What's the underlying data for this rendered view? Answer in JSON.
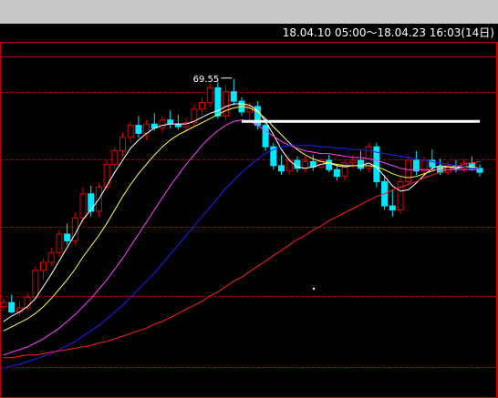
{
  "window": {
    "titlebar_color": "#c8c8c8"
  },
  "header": {
    "range_text": "18.04.10 05:00～18.04.23 16:03(14日)"
  },
  "colors": {
    "background": "#000000",
    "frame": "#c00000",
    "grid": "#a00000",
    "up_candle": "#e00000",
    "down_candle": "#00e8ff",
    "ma_white": "#ffffff",
    "ma_yellow": "#ffff40",
    "ma_magenta": "#ff40ff",
    "ma_blue": "#2020ff",
    "ma_red": "#ff2020",
    "trendline": "#ffffff"
  },
  "chart_data": {
    "type": "candlestick",
    "title": "",
    "high_label": "69.55",
    "ylim": [
      46.0,
      71.5
    ],
    "grid": true,
    "candles": [
      [
        52.6,
        53.2,
        52.3,
        52.9
      ],
      [
        52.9,
        53.5,
        52.1,
        52.2
      ],
      [
        52.2,
        53.0,
        51.9,
        52.5
      ],
      [
        52.5,
        53.6,
        52.3,
        53.3
      ],
      [
        53.3,
        55.6,
        53.1,
        55.3
      ],
      [
        55.3,
        56.2,
        54.6,
        55.9
      ],
      [
        55.9,
        57.0,
        55.6,
        56.6
      ],
      [
        56.6,
        58.3,
        56.3,
        58.0
      ],
      [
        58.0,
        58.8,
        57.2,
        57.5
      ],
      [
        57.5,
        59.6,
        57.2,
        59.2
      ],
      [
        59.2,
        61.5,
        58.8,
        61.0
      ],
      [
        61.0,
        61.6,
        59.3,
        59.7
      ],
      [
        59.7,
        61.8,
        59.3,
        61.5
      ],
      [
        61.5,
        63.5,
        61.2,
        63.2
      ],
      [
        63.2,
        64.5,
        62.9,
        64.2
      ],
      [
        64.2,
        65.6,
        63.8,
        65.2
      ],
      [
        65.2,
        66.4,
        64.8,
        66.1
      ],
      [
        66.1,
        66.8,
        65.2,
        65.5
      ],
      [
        65.5,
        66.5,
        65.0,
        66.2
      ],
      [
        66.2,
        67.0,
        65.7,
        65.9
      ],
      [
        65.9,
        66.8,
        65.5,
        66.5
      ],
      [
        66.5,
        67.2,
        65.9,
        66.2
      ],
      [
        66.2,
        66.9,
        65.8,
        66.0
      ],
      [
        66.0,
        66.6,
        65.6,
        66.3
      ],
      [
        66.3,
        67.6,
        66.0,
        67.3
      ],
      [
        67.3,
        68.2,
        66.9,
        67.8
      ],
      [
        67.8,
        69.2,
        67.5,
        68.9
      ],
      [
        68.9,
        69.3,
        66.6,
        66.8
      ],
      [
        66.8,
        69.1,
        66.5,
        68.6
      ],
      [
        68.6,
        69.55,
        67.6,
        67.9
      ],
      [
        67.9,
        68.2,
        66.8,
        67.1
      ],
      [
        67.1,
        67.8,
        66.5,
        67.5
      ],
      [
        67.5,
        67.9,
        65.8,
        66.1
      ],
      [
        66.1,
        66.6,
        64.2,
        64.5
      ],
      [
        64.5,
        64.8,
        62.8,
        63.1
      ],
      [
        63.1,
        63.9,
        62.4,
        62.7
      ],
      [
        62.7,
        63.7,
        62.4,
        63.5
      ],
      [
        63.5,
        63.8,
        62.6,
        62.9
      ],
      [
        62.9,
        63.8,
        62.6,
        63.4
      ],
      [
        63.4,
        63.9,
        62.7,
        63.0
      ],
      [
        63.0,
        63.7,
        62.8,
        63.5
      ],
      [
        63.5,
        63.9,
        62.6,
        62.8
      ],
      [
        62.8,
        63.2,
        62.0,
        62.3
      ],
      [
        62.3,
        63.6,
        62.0,
        63.3
      ],
      [
        63.3,
        63.9,
        62.9,
        63.5
      ],
      [
        63.5,
        64.2,
        62.7,
        62.9
      ],
      [
        62.9,
        64.8,
        62.6,
        64.5
      ],
      [
        64.5,
        64.8,
        61.5,
        61.9
      ],
      [
        61.9,
        62.4,
        59.8,
        60.1
      ],
      [
        60.1,
        61.3,
        59.3,
        59.8
      ],
      [
        59.8,
        62.2,
        59.5,
        61.9
      ],
      [
        61.9,
        63.8,
        61.6,
        63.5
      ],
      [
        63.5,
        64.2,
        62.4,
        62.7
      ],
      [
        62.7,
        63.8,
        62.3,
        63.5
      ],
      [
        63.5,
        64.3,
        62.8,
        63.0
      ],
      [
        63.0,
        63.6,
        62.4,
        62.6
      ],
      [
        62.6,
        63.4,
        62.4,
        63.1
      ],
      [
        63.1,
        63.5,
        62.6,
        62.9
      ],
      [
        62.9,
        63.6,
        62.6,
        63.3
      ],
      [
        63.3,
        63.8,
        62.7,
        62.9
      ],
      [
        62.9,
        63.2,
        62.3,
        62.6
      ]
    ],
    "moving_averages": [
      {
        "color": "#ffffff",
        "values": [
          51.5,
          51.9,
          52.2,
          52.6,
          53.2,
          54.1,
          55.0,
          56.0,
          57.0,
          58.0,
          59.1,
          59.8,
          60.6,
          61.6,
          62.6,
          63.5,
          64.4,
          65.0,
          65.5,
          65.9,
          66.1,
          66.2,
          66.2,
          66.2,
          66.4,
          66.7,
          67.0,
          67.2,
          67.5,
          67.7,
          67.7,
          67.6,
          67.2,
          66.4,
          65.4,
          64.3,
          63.5,
          63.0,
          62.9,
          63.0,
          63.2,
          63.3,
          63.1,
          63.0,
          63.1,
          63.1,
          63.3,
          63.0,
          62.3,
          61.6,
          61.2,
          61.3,
          61.8,
          62.4,
          62.9,
          63.1,
          63.0,
          62.9,
          63.0,
          63.0,
          62.9
        ]
      },
      {
        "color": "#ffff40",
        "values": [
          50.8,
          51.1,
          51.4,
          51.7,
          52.1,
          52.6,
          53.2,
          53.9,
          54.6,
          55.4,
          56.3,
          57.1,
          57.9,
          58.8,
          59.8,
          60.8,
          61.7,
          62.5,
          63.2,
          63.9,
          64.5,
          65.0,
          65.4,
          65.7,
          66.0,
          66.3,
          66.6,
          66.9,
          67.2,
          67.4,
          67.5,
          67.4,
          67.1,
          66.6,
          66.0,
          65.4,
          64.8,
          64.3,
          63.9,
          63.6,
          63.4,
          63.3,
          63.2,
          63.1,
          63.1,
          63.1,
          63.1,
          63.0,
          62.8,
          62.5,
          62.3,
          62.2,
          62.3,
          62.5,
          62.7,
          62.9,
          63.0,
          63.0,
          63.0,
          63.0,
          62.9
        ]
      },
      {
        "color": "#ff40ff",
        "values": [
          49.0,
          49.2,
          49.4,
          49.6,
          49.9,
          50.2,
          50.6,
          51.0,
          51.5,
          52.0,
          52.6,
          53.2,
          53.9,
          54.6,
          55.4,
          56.2,
          57.1,
          58.0,
          58.9,
          59.8,
          60.7,
          61.6,
          62.4,
          63.2,
          63.9,
          64.6,
          65.2,
          65.7,
          66.1,
          66.4,
          66.5,
          66.4,
          66.1,
          65.7,
          65.3,
          64.9,
          64.6,
          64.4,
          64.2,
          64.1,
          64.0,
          64.0,
          63.9,
          63.8,
          63.7,
          63.7,
          63.6,
          63.5,
          63.3,
          63.1,
          62.9,
          62.8,
          62.8,
          62.8,
          62.8,
          62.8,
          62.8,
          62.8,
          62.8,
          62.8,
          62.8
        ]
      },
      {
        "color": "#2020ff",
        "values": [
          48.0,
          48.2,
          48.3,
          48.5,
          48.7,
          48.9,
          49.1,
          49.4,
          49.7,
          50.0,
          50.4,
          50.8,
          51.2,
          51.7,
          52.2,
          52.7,
          53.3,
          53.9,
          54.5,
          55.1,
          55.8,
          56.5,
          57.2,
          57.9,
          58.6,
          59.3,
          60.0,
          60.7,
          61.4,
          62.0,
          62.6,
          63.1,
          63.6,
          64.0,
          64.3,
          64.5,
          64.6,
          64.6,
          64.6,
          64.6,
          64.5,
          64.5,
          64.4,
          64.4,
          64.3,
          64.3,
          64.2,
          64.1,
          64.0,
          63.9,
          63.8,
          63.7,
          63.6,
          63.5,
          63.4,
          63.3,
          63.2,
          63.1,
          63.0,
          62.9,
          62.9
        ]
      },
      {
        "color": "#ff2020",
        "values": [
          48.8,
          48.8,
          48.9,
          49.0,
          49.0,
          49.1,
          49.2,
          49.3,
          49.4,
          49.5,
          49.6,
          49.7,
          49.9,
          50.0,
          50.2,
          50.4,
          50.6,
          50.8,
          51.0,
          51.3,
          51.5,
          51.8,
          52.1,
          52.4,
          52.7,
          53.0,
          53.4,
          53.7,
          54.1,
          54.5,
          54.8,
          55.2,
          55.6,
          56.0,
          56.4,
          56.8,
          57.2,
          57.6,
          57.9,
          58.3,
          58.6,
          59.0,
          59.3,
          59.6,
          59.9,
          60.2,
          60.5,
          60.8,
          61.0,
          61.3,
          61.5,
          61.7,
          61.9,
          62.2,
          62.4,
          62.6,
          62.8,
          63.0,
          63.2,
          63.3,
          63.4
        ]
      }
    ],
    "trendline": {
      "level": 66.4,
      "from_index": 30,
      "to_index": 60
    }
  }
}
